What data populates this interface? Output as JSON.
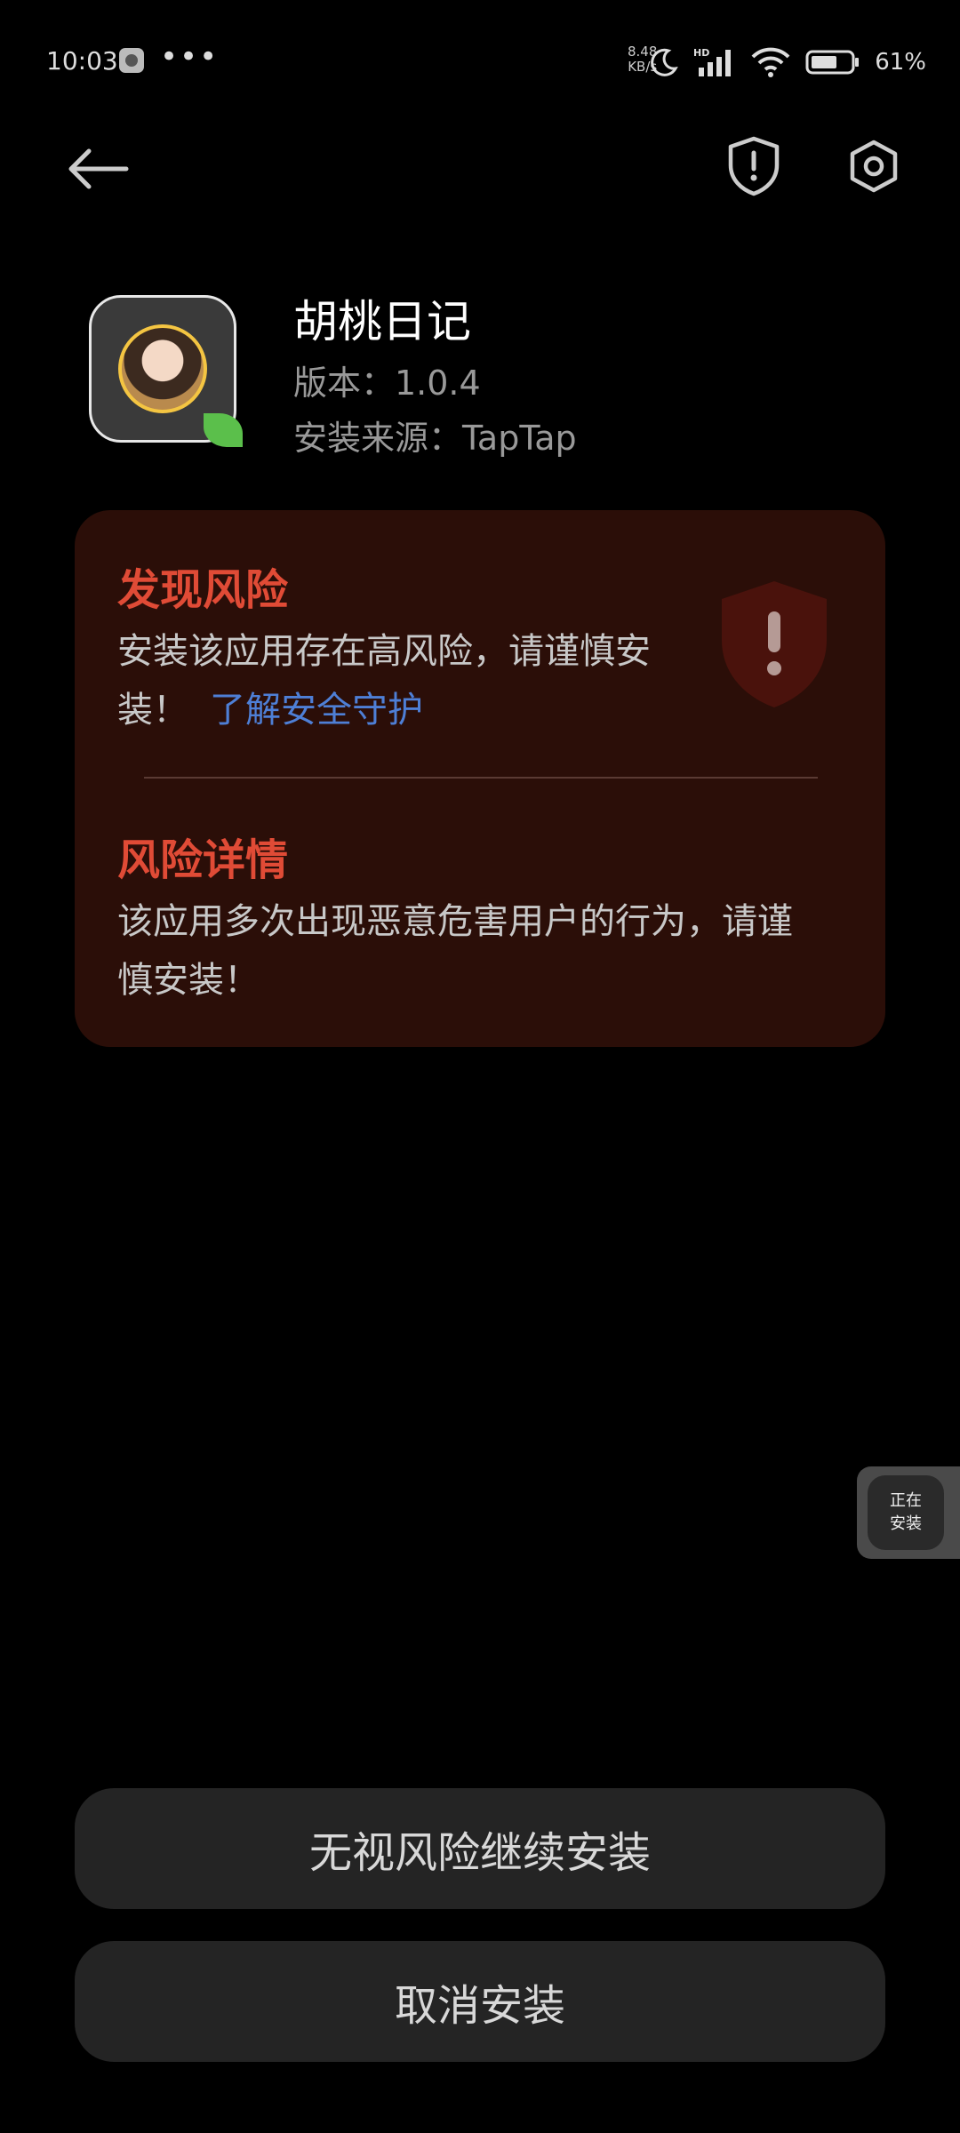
{
  "status_bar": {
    "time": "10:03",
    "dots": "•••",
    "net_speed_value": "8.48",
    "net_speed_unit": "KB/s",
    "battery": "61%",
    "icons": [
      "moon-icon",
      "hd-signal-icon",
      "wifi-icon",
      "battery-icon"
    ]
  },
  "app": {
    "name": "胡桃日记",
    "version": "版本：1.0.4",
    "source": "安装来源：TapTap",
    "icon": "app-icon"
  },
  "warning": {
    "title": "发现风险",
    "text": "安装该应用存在高风险，请谨慎安装！",
    "link": "了解安全守护",
    "detail_title": "风险详情",
    "detail_text": "该应用多次出现恶意危害用户的行为，请谨慎安装！",
    "accent_color": "#e04b36",
    "link_color": "#4e7fd6"
  },
  "float_bubble": {
    "label": "正在安装"
  },
  "buttons": {
    "continue": "无视风险继续安装",
    "cancel": "取消安装"
  }
}
